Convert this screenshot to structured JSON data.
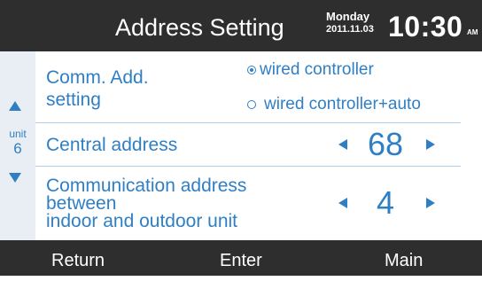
{
  "header": {
    "title": "Address Setting",
    "day": "Monday",
    "date": "2011.11.03",
    "time": "10:30",
    "ampm": "AM"
  },
  "side": {
    "unit_label": "unit",
    "unit_value": "6"
  },
  "comm_add": {
    "label_line1": "Comm. Add.",
    "label_line2": "setting",
    "options": [
      "wired controller",
      "wired controller+auto"
    ],
    "selected": "wired controller"
  },
  "central": {
    "label": "Central address",
    "value": "68"
  },
  "comm_address": {
    "label_line1": "Communication address",
    "label_line2": "between",
    "label_line3": "indoor and outdoor unit",
    "value": "4"
  },
  "footer": {
    "return_label": "Return",
    "enter_label": "Enter",
    "main_label": "Main"
  },
  "colors": {
    "accent": "#2f7fc4",
    "bar": "#2e2e2e",
    "side": "#e9eef4"
  }
}
